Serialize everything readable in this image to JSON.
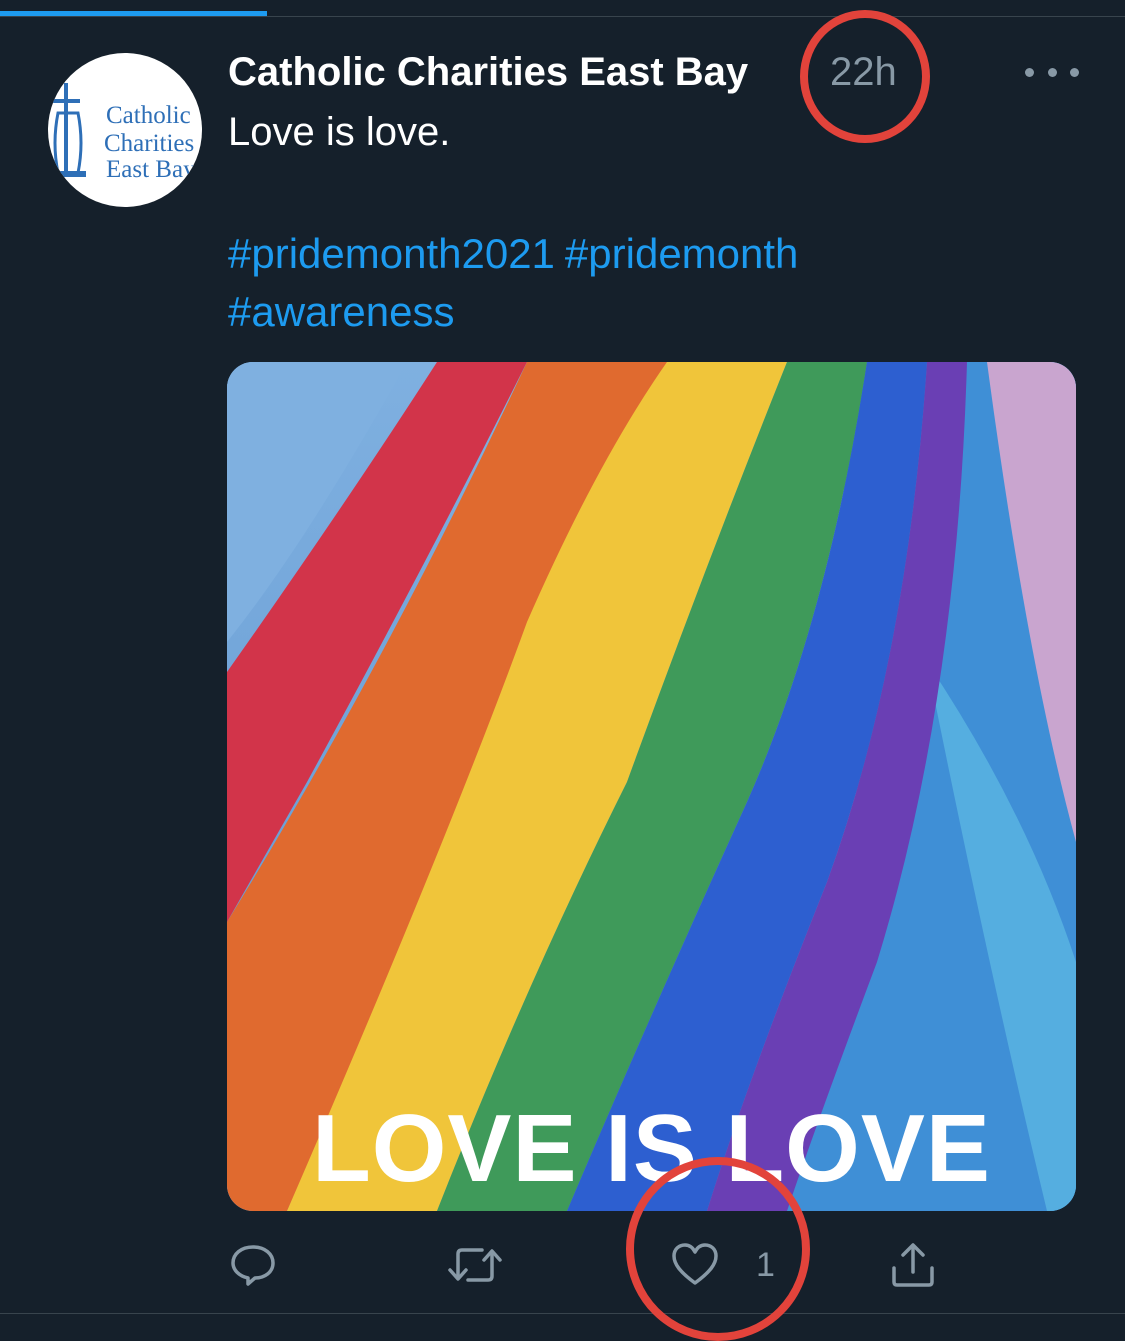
{
  "tweet": {
    "author": {
      "display_name": "Catholic Charities East Bay",
      "avatar_lines": [
        "Catholic",
        "Charities",
        "East Bay"
      ]
    },
    "timestamp": "22h",
    "text": "Love is love.",
    "hashtags": [
      "#pridemonth2021",
      "#pridemonth",
      "#awareness"
    ],
    "media": {
      "caption": "LOVE IS LOVE"
    },
    "actions": {
      "reply_icon": "reply-icon",
      "retweet_icon": "retweet-icon",
      "like_icon": "heart-icon",
      "like_count": "1",
      "share_icon": "share-icon"
    }
  },
  "colors": {
    "background": "#15202b",
    "link": "#1d9bf0",
    "muted": "#8899a6",
    "annotation": "#e2433b"
  }
}
